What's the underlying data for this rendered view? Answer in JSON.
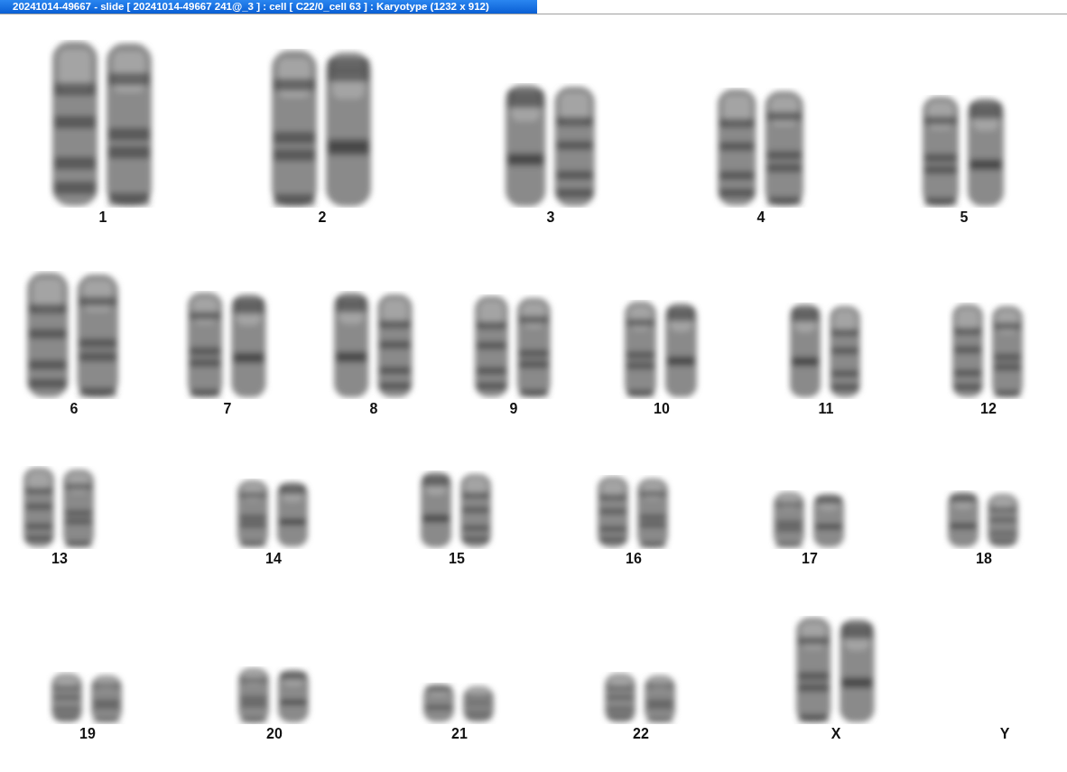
{
  "window": {
    "title": "20241014-49667 - slide [ 20241014-49667 241@_3 ] : cell [ C22/0_cell 63 ] : Karyotype  (1232 x 912)"
  },
  "karyotype": {
    "rows": [
      {
        "pairs": [
          {
            "label": "1",
            "kind": "pair"
          },
          {
            "label": "2",
            "kind": "pair"
          },
          {
            "label": "3",
            "kind": "pair"
          },
          {
            "label": "4",
            "kind": "pair"
          },
          {
            "label": "5",
            "kind": "pair"
          }
        ]
      },
      {
        "pairs": [
          {
            "label": "6",
            "kind": "pair"
          },
          {
            "label": "7",
            "kind": "pair"
          },
          {
            "label": "8",
            "kind": "pair"
          },
          {
            "label": "9",
            "kind": "pair"
          },
          {
            "label": "10",
            "kind": "pair"
          },
          {
            "label": "11",
            "kind": "pair"
          },
          {
            "label": "12",
            "kind": "pair"
          }
        ]
      },
      {
        "pairs": [
          {
            "label": "13",
            "kind": "pair"
          },
          {
            "label": "14",
            "kind": "pair"
          },
          {
            "label": "15",
            "kind": "pair"
          },
          {
            "label": "16",
            "kind": "pair"
          },
          {
            "label": "17",
            "kind": "pair"
          },
          {
            "label": "18",
            "kind": "pair"
          }
        ]
      },
      {
        "pairs": [
          {
            "label": "19",
            "kind": "pair"
          },
          {
            "label": "20",
            "kind": "pair"
          },
          {
            "label": "21",
            "kind": "pair"
          },
          {
            "label": "22",
            "kind": "pair"
          },
          {
            "label": "X",
            "kind": "pair"
          },
          {
            "label": "Y",
            "kind": "empty"
          }
        ]
      }
    ]
  }
}
